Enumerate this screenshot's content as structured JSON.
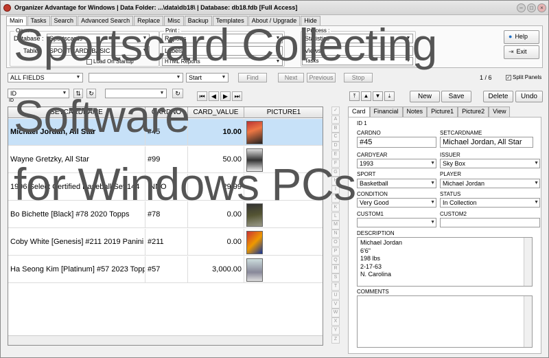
{
  "window": {
    "title": "Organizer Advantage for Windows | Data Folder: ...\\data\\db18\\ | Database: db18.fdb [Full Access]"
  },
  "main_tabs": [
    "Main",
    "Tasks",
    "Search",
    "Advanced Search",
    "Replace",
    "Misc",
    "Backup",
    "Templates",
    "About / Upgrade",
    "Hide"
  ],
  "ribbon": {
    "open_group": "Open :",
    "database_label": "Database :",
    "database_value": "Sportscards",
    "table_label": "Table :",
    "table_value": "SPORTCARD_BASIC",
    "load_on_startup": "Load On Startup",
    "print_group": "Print :",
    "reports_label": "Reports",
    "labels_label": "Labels",
    "html_reports": "HTML Reports",
    "process_group": "Process :",
    "statistics": "Statistics",
    "views": "Views",
    "tasks": "Tasks",
    "help_button": "Help",
    "exit_button": "Exit"
  },
  "search": {
    "field_value": "ALL FIELDS",
    "start_value": "Start",
    "find_button": "Find",
    "next_button": "Next",
    "previous_button": "Previous",
    "stop_button": "Stop",
    "page_info": "1 / 6",
    "split_panels": "Split Panels"
  },
  "sort": {
    "field_value": "ID",
    "id_label": "ID"
  },
  "grid": {
    "headers": [
      "SETCARDNAME",
      "CARDNO",
      "CARD_VALUE",
      "PICTURE1"
    ],
    "rows": [
      {
        "name": "Michael Jordan, All Star",
        "no": "#45",
        "value": "10.00"
      },
      {
        "name": "Wayne Gretzky, All Star",
        "no": "#99",
        "value": "50.00"
      },
      {
        "name": "1996 Select Certified Baseball Set 144",
        "no": "INNO",
        "value": "29.99"
      },
      {
        "name": "Bo Bichette [Black] #78 2020 Topps",
        "no": "#78",
        "value": "0.00"
      },
      {
        "name": "Coby White [Genesis] #211 2019 Panini",
        "no": "#211",
        "value": "0.00"
      },
      {
        "name": "Ha Seong Kim [Platinum] #57 2023 Topps",
        "no": "#57",
        "value": "3,000.00"
      }
    ]
  },
  "alpha_index": [
    "A",
    "B",
    "C",
    "D",
    "E",
    "F",
    "G",
    "H",
    "I",
    "J",
    "K",
    "L",
    "M",
    "N",
    "O",
    "P",
    "Q",
    "R",
    "S",
    "T",
    "U",
    "V",
    "W",
    "X",
    "Y",
    "Z"
  ],
  "record_actions": {
    "new": "New",
    "save": "Save",
    "delete": "Delete",
    "undo": "Undo"
  },
  "record_tabs": [
    "Card",
    "Financial",
    "Notes",
    "Picture1",
    "Picture2",
    "View"
  ],
  "form": {
    "id_line": "ID 1",
    "cardno_label": "CARDNO",
    "cardno_value": "#45",
    "setcardname_label": "SETCARDNAME",
    "setcardname_value": "Michael Jordan, All Star",
    "cardyear_label": "CARDYEAR",
    "cardyear_value": "1993",
    "issuer_label": "ISSUER",
    "issuer_value": "Sky Box",
    "sport_label": "SPORT",
    "sport_value": "Basketball",
    "player_label": "PLAYER",
    "player_value": "Michael Jordan",
    "condition_label": "CONDITION",
    "condition_value": "Very Good",
    "status_label": "STATUS",
    "status_value": "In Collection",
    "custom1_label": "CUSTOM1",
    "custom2_label": "CUSTOM2",
    "description_label": "DESCRIPTION",
    "description_value": "Michael Jordan\n6'6\"\n198 lbs\n2-17-63\nN. Carolina",
    "comments_label": "COMMENTS"
  },
  "overlay": {
    "line1": "Sportscard Collecting",
    "line2": "Software",
    "line3": "for Windows PCs"
  }
}
